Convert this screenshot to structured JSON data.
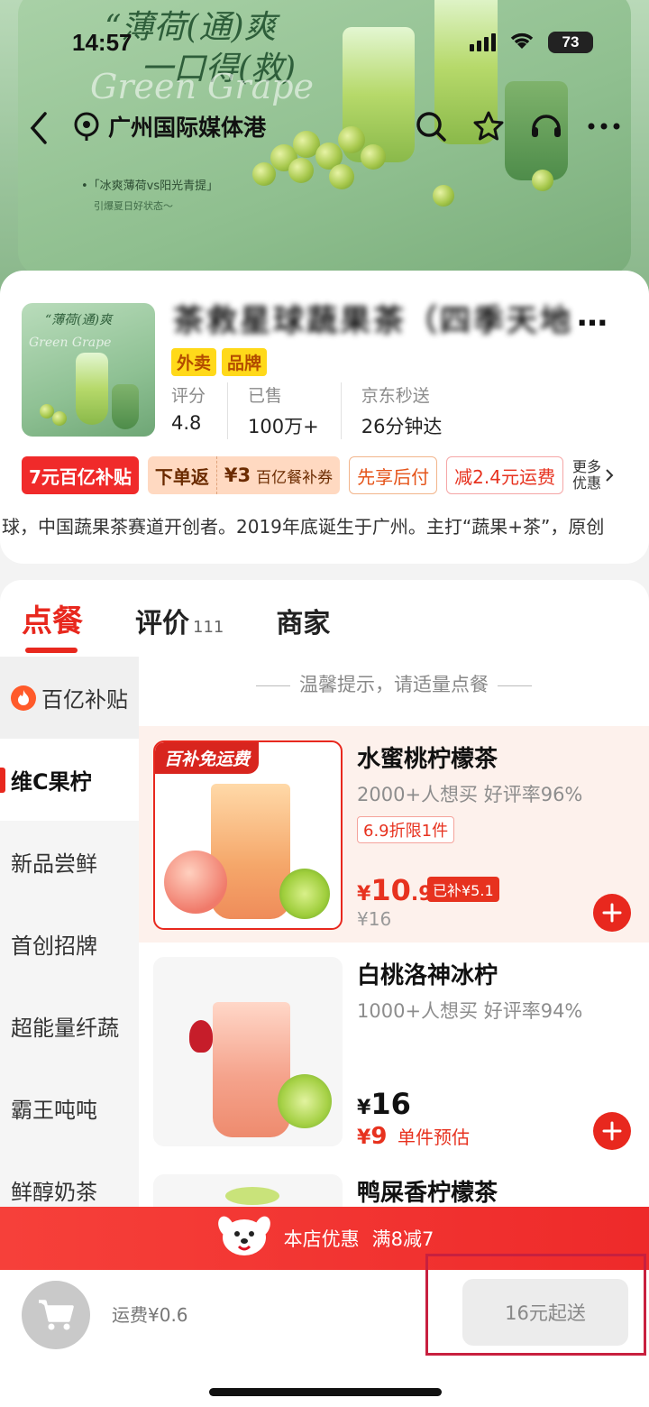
{
  "status": {
    "time": "14:57",
    "battery": "73"
  },
  "banner": {
    "headline_1": "“薄荷(通)爽",
    "headline_2": "一口得(救)",
    "english": "Green Grape",
    "caption": "•「冰爽薄荷vs阳光青提」",
    "caption_sub": "引爆夏日好状态～"
  },
  "nav": {
    "location": "广州国际媒体港"
  },
  "store": {
    "name": "茶救星球蔬果茶（四季天地",
    "name_ellipsis": "…",
    "tags": [
      "外卖",
      "品牌"
    ],
    "stats": [
      {
        "label": "评分",
        "value": "4.8"
      },
      {
        "label": "已售",
        "value": "100万+"
      },
      {
        "label": "京东秒送",
        "value": "26分钟达"
      }
    ],
    "promos": {
      "subsidy": "7元百亿补贴",
      "return_label": "下单返",
      "return_amount": "¥3",
      "return_text": "百亿餐补券",
      "pay_later": "先享后付",
      "shipping": "减2.4元运费",
      "more_1": "更多",
      "more_2": "优惠"
    },
    "intro": "球，中国蔬果茶赛道开创者。2019年底诞生于广州。主打“蔬果+茶”，原创"
  },
  "menu": {
    "tabs": [
      {
        "label": "点餐"
      },
      {
        "label": "评价",
        "count": "111"
      },
      {
        "label": "商家"
      }
    ],
    "sidebar": [
      "百亿补贴",
      "维C果柠",
      "新品尝鲜",
      "首创招牌",
      "超能量纤蔬",
      "霸王吨吨",
      "鲜醇奶茶"
    ],
    "tip": "温馨提示，请适量点餐",
    "items": [
      {
        "ribbon": "百补免运费",
        "name": "水蜜桃柠檬茶",
        "meta": "2000+人想买  好评率96%",
        "discount": "6.9折限1件",
        "price_yen": "¥",
        "price_int": "10",
        "price_dec": ".9",
        "subsidy": "已补¥5.1",
        "orig": "¥16"
      },
      {
        "name": "白桃洛神冰柠",
        "meta": "1000+人想买  好评率94%",
        "price_yen": "¥",
        "price_int": "16",
        "est_yen": "¥",
        "est_int": "9",
        "est_text": "单件预估"
      },
      {
        "name": "鸭屎香柠檬茶"
      }
    ]
  },
  "bottom": {
    "store_deal_label": "本店优惠",
    "store_deal": "满8减7",
    "delivery_fee": "运费¥0.6",
    "min_order": "16元起送"
  },
  "colors": {
    "accent": "#e8281e",
    "promo_bar": "#f0302e",
    "banner_green": "#9cc59d"
  }
}
